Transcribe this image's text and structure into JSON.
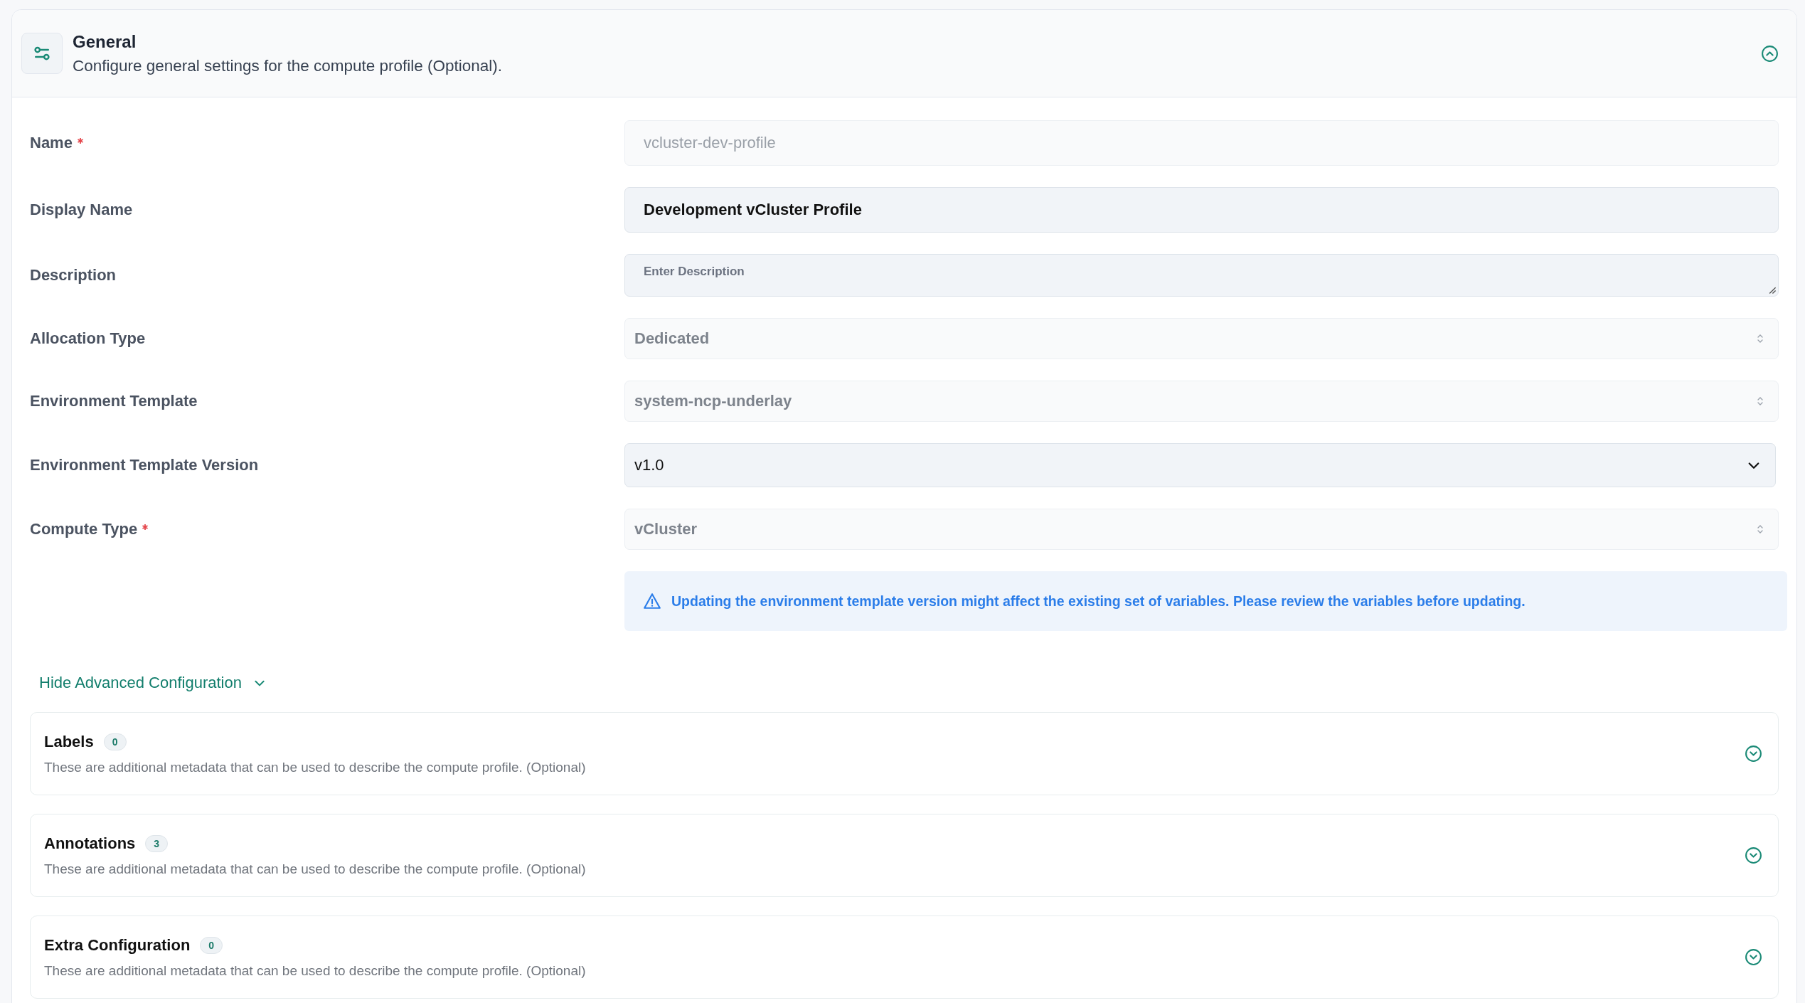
{
  "section": {
    "title": "General",
    "subtitle": "Configure general settings for the compute profile (Optional).",
    "expanded": true
  },
  "fields": [
    {
      "label": "Name",
      "required": true,
      "kind": "text",
      "value": "vcluster-dev-profile",
      "disabled": true
    },
    {
      "label": "Display Name",
      "required": false,
      "kind": "text",
      "value": "Development vCluster Profile",
      "disabled": false
    },
    {
      "label": "Description",
      "required": false,
      "kind": "textarea",
      "placeholder": "Enter Description",
      "disabled": false
    },
    {
      "label": "Allocation Type",
      "required": false,
      "kind": "select",
      "value": "Dedicated",
      "disabled": true
    },
    {
      "label": "Environment Template",
      "required": false,
      "kind": "select",
      "value": "system-ncp-underlay",
      "disabled": true
    },
    {
      "label": "Environment Template Version",
      "required": false,
      "kind": "select",
      "value": "v1.0",
      "disabled": false
    },
    {
      "label": "Compute Type",
      "required": true,
      "kind": "select",
      "value": "vCluster",
      "disabled": true
    }
  ],
  "alert": {
    "text": "Updating the environment template version might affect the existing set of variables. Please review the variables before updating."
  },
  "advanced_toggle": {
    "label": "Hide Advanced Configuration",
    "expanded": true
  },
  "subsections": [
    {
      "title": "Labels",
      "count": "0",
      "description": "These are additional metadata that can be used to describe the compute profile. (Optional)",
      "expanded": false
    },
    {
      "title": "Annotations",
      "count": "3",
      "description": "These are additional metadata that can be used to describe the compute profile. (Optional)",
      "expanded": false
    },
    {
      "title": "Extra Configuration",
      "count": "0",
      "description": "These are additional metadata that can be used to describe the compute profile. (Optional)",
      "expanded": false
    }
  ]
}
